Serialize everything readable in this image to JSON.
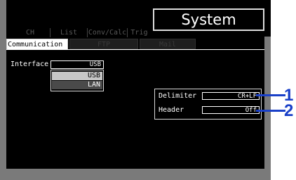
{
  "header": {
    "screen_title": "System"
  },
  "tabs": [
    {
      "label": "CH"
    },
    {
      "label": "List"
    },
    {
      "label": "Conv/Calc"
    },
    {
      "label": "Trig&Alm"
    }
  ],
  "subtabs": [
    {
      "label": "Communication"
    },
    {
      "label": "FTP"
    },
    {
      "label": "Mail"
    }
  ],
  "interface": {
    "label": "Interface",
    "value": "USB",
    "options": [
      {
        "label": "USB"
      },
      {
        "label": "LAN"
      }
    ]
  },
  "settings": {
    "delimiter_label": "Delimiter",
    "delimiter_value": "CR+LF",
    "header_label": "Header",
    "header_value": "Off"
  },
  "annotations": {
    "marker_1": "1",
    "marker_2": "2",
    "color": "#1a40c8"
  }
}
